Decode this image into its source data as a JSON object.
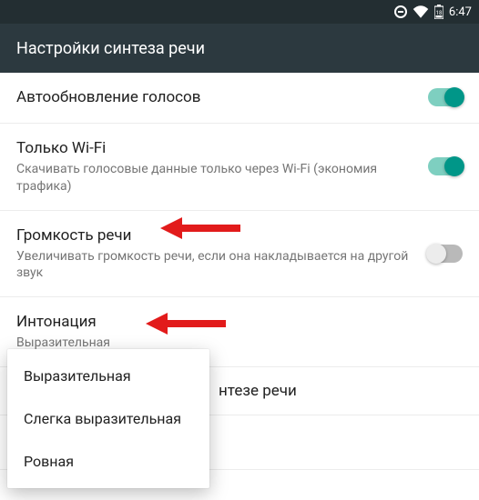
{
  "statusbar": {
    "time": "6:47",
    "battery": "18"
  },
  "appbar": {
    "title": "Настройки синтеза речи"
  },
  "settings": {
    "auto_update": {
      "title": "Автообновление голосов",
      "on": true
    },
    "wifi_only": {
      "title": "Только Wi-Fi",
      "sub": "Скачивать голосовые данные только через Wi-Fi (экономия трафика)",
      "on": true
    },
    "volume": {
      "title": "Громкость речи",
      "sub": "Увеличивать громкость речи, если она накладывается на другой звук",
      "on": false
    },
    "intonation": {
      "title": "Интонация",
      "sub": "Выразительная"
    },
    "peek_partial": "нтезе речи"
  },
  "menu": {
    "items": [
      "Выразительная",
      "Слегка выразительная",
      "Ровная"
    ]
  }
}
